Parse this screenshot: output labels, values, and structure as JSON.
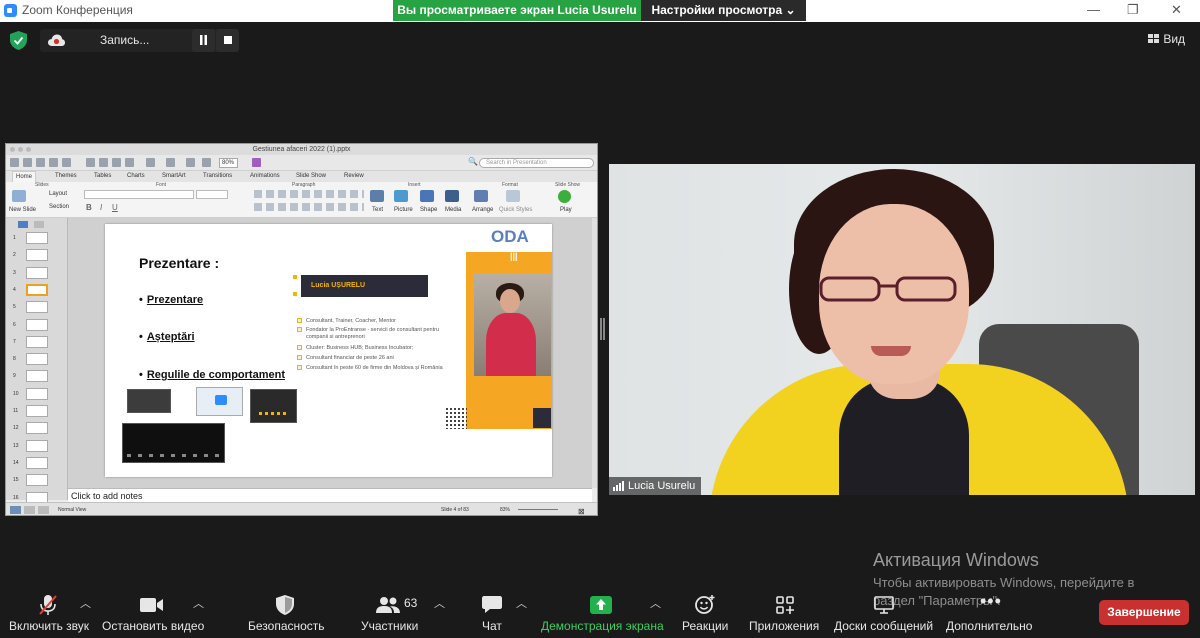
{
  "window": {
    "app_title": "Zoom Конференция",
    "share_banner": "Вы просматриваете экран Lucia Usurelu",
    "view_options": "Настройки просмотра ⌄",
    "controls": {
      "minimize": "—",
      "restore": "❐",
      "close": "✕"
    }
  },
  "topbar": {
    "recording_label": "Запись...",
    "view_button": "Вид"
  },
  "powerpoint": {
    "file_title": "Gestiunea afaceri 2022 (1).pptx",
    "zoom_value": "80%",
    "search_placeholder": "Search in Presentation",
    "tabs": [
      "Home",
      "Themes",
      "Tables",
      "Charts",
      "SmartArt",
      "Transitions",
      "Animations",
      "Slide Show",
      "Review"
    ],
    "ribbon_groups": [
      "Slides",
      "Font",
      "Paragraph",
      "Insert",
      "Format",
      "Slide Show"
    ],
    "ribbon_buttons": {
      "new_slide": "New Slide",
      "layout": "Layout",
      "section": "Section",
      "text": "Text",
      "picture": "Picture",
      "shape": "Shape",
      "media": "Media",
      "arrange": "Arrange",
      "quick_styles": "Quick Styles",
      "play": "Play"
    },
    "thumbnail_numbers": [
      "1",
      "2",
      "3",
      "4",
      "5",
      "6",
      "7",
      "8",
      "9",
      "10",
      "11",
      "12",
      "13",
      "14",
      "15",
      "16"
    ],
    "selected_slide": 4,
    "slide": {
      "title": "Prezentare :",
      "bullets": [
        "Prezentare",
        "Așteptări",
        "Regulile de comportament"
      ],
      "name_bar": "Lucia UȘURELU",
      "items": [
        "Consultant, Trainer, Coacher, Mentor",
        "Fondator la ProEntranse - servicii de consultant pentru companii si antreprenori",
        "Cluster: Business HUB; Business Incubator;",
        "Consultant  financiar de peste 26 ani",
        "Consultant  în peste 60 de firme din Moldova și România"
      ],
      "logo": "ODA"
    },
    "notes_placeholder": "Click to add notes",
    "status": {
      "view": "Normal View",
      "slide_of": "Slide 4 of 83",
      "zoom": "83%"
    }
  },
  "video": {
    "participant_name": "Lucia Usurelu"
  },
  "activation": {
    "title": "Активация Windows",
    "subtitle": "Чтобы активировать Windows, перейдите в раздел \"Параметры\"."
  },
  "toolbar": {
    "unmute": "Включить звук",
    "stop_video": "Остановить видео",
    "security": "Безопасность",
    "participants": "Участники",
    "participants_count": "63",
    "chat": "Чат",
    "share_screen": "Демонстрация экрана",
    "reactions": "Реакции",
    "apps": "Приложения",
    "whiteboards": "Доски сообщений",
    "more": "Дополнительно",
    "end": "Завершение"
  },
  "colors": {
    "share_green": "#27a343",
    "end_red": "#c8312f",
    "slide_orange": "#f5a623",
    "jacket_yellow": "#f2d21e"
  }
}
